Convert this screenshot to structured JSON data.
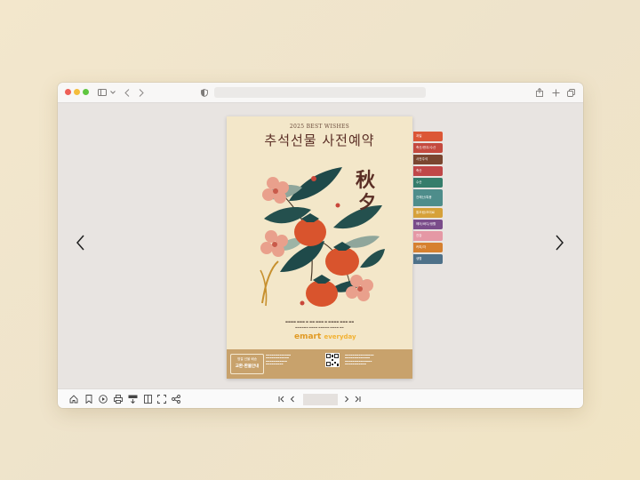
{
  "poster": {
    "subtitle": "2025 BEST WISHES",
    "title": "추석선물 사전예약",
    "calligraphy_top": "秋",
    "calligraphy_bottom": "夕",
    "brand_e": "e",
    "brand_mart": "mart",
    "brand_everyday": "everyday",
    "badge_line1": "명절 선물 배송",
    "badge_line2": "교환·환불안내"
  },
  "tabs": [
    {
      "label": "과일",
      "color": "#dc5736"
    },
    {
      "label": "축산/한우/수산",
      "color": "#c44a3f"
    },
    {
      "label": "사전주석",
      "color": "#7a4630"
    },
    {
      "label": "축산",
      "color": "#c04748"
    },
    {
      "label": "수산",
      "color": "#357d6b"
    },
    {
      "label": "건해산/특용",
      "color": "#4e8d8b"
    },
    {
      "label": "통조림/조미료",
      "color": "#d6a139"
    },
    {
      "label": "헤어/바디/생활",
      "color": "#7a4c8a"
    },
    {
      "label": "건강",
      "color": "#e598a5"
    },
    {
      "label": "커피/차",
      "color": "#d6802f"
    },
    {
      "label": "생활",
      "color": "#4e7189"
    }
  ],
  "icons": {
    "toolbar": [
      "sidebar-icon",
      "chevron-down-icon",
      "back-icon",
      "forward-icon",
      "shield-icon",
      "share-icon",
      "new-tab-icon",
      "tabs-icon"
    ],
    "bottom": [
      "home-icon",
      "bookmark-icon",
      "play-icon",
      "print-icon",
      "pdf-download-icon",
      "single-page-icon",
      "fullscreen-icon",
      "share-icon"
    ],
    "pager": [
      "first-page-icon",
      "prev-page-icon",
      "next-page-icon",
      "last-page-icon"
    ]
  },
  "colors": {
    "persimmon": "#d9542d",
    "leaf_dark": "#1f4a4a",
    "leaf_light": "#8fa69b",
    "flower": "#e9a08c",
    "poster_bg": "#f3e7c9",
    "poster_footer": "#c8a26c"
  }
}
